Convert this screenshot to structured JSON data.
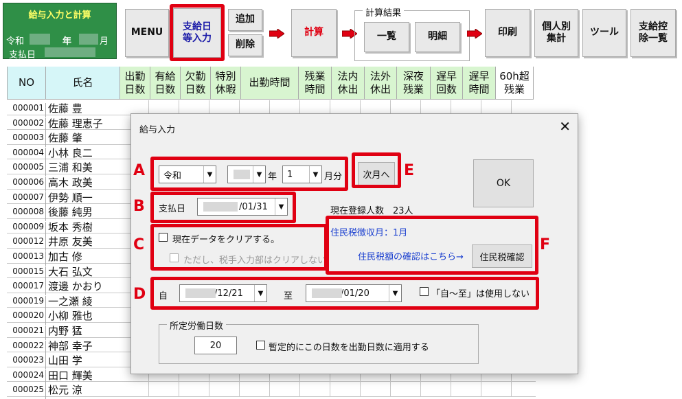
{
  "header": {
    "app_title": "給与入力と計算",
    "era_label": "令和",
    "year_label": "年",
    "month_label": "月",
    "pay_label": "支払日"
  },
  "toolbar": {
    "menu": "MENU",
    "pay_date_entry": "支給日\n等入力",
    "add": "追加",
    "delete": "削除",
    "calc": "計算",
    "calc_result_group": "計算結果",
    "list": "一覧",
    "detail": "明細",
    "print": "印刷",
    "individual": "個人別\n集計",
    "tools": "ツール",
    "deduction_list": "支給控\n除一覧"
  },
  "grid": {
    "headers": [
      "NO",
      "氏名",
      "出勤\n日数",
      "有給\n日数",
      "欠勤\n日数",
      "特別\n休暇",
      "出勤時間",
      "残業\n時間",
      "法内\n休出",
      "法外\n休出",
      "深夜\n残業",
      "遅早\n回数",
      "遅早\n時間",
      "60h超\n残業"
    ],
    "rows": [
      [
        "000001",
        "佐藤 豊"
      ],
      [
        "000002",
        "佐藤 理恵子"
      ],
      [
        "000003",
        "佐藤 肇"
      ],
      [
        "000004",
        "小林 良二"
      ],
      [
        "000005",
        "三浦 和美"
      ],
      [
        "000006",
        "高木 政美"
      ],
      [
        "000007",
        "伊勢 順一"
      ],
      [
        "000008",
        "後藤 純男"
      ],
      [
        "000009",
        "坂本 秀樹"
      ],
      [
        "000012",
        "井原 友美"
      ],
      [
        "000013",
        "加古 修"
      ],
      [
        "000015",
        "大石 弘文"
      ],
      [
        "000017",
        "渡邊 かおり"
      ],
      [
        "000019",
        "一之瀬 綾"
      ],
      [
        "000020",
        "小柳 雅也"
      ],
      [
        "000021",
        "内野 猛"
      ],
      [
        "000022",
        "神部 幸子"
      ],
      [
        "000023",
        "山田 学"
      ],
      [
        "000024",
        "田口 輝美"
      ],
      [
        "000025",
        "松元 涼"
      ]
    ]
  },
  "dialog": {
    "title": "給与入力",
    "close": "✕",
    "era": "令和",
    "year_label": "年",
    "month": "1",
    "month_label": "月分",
    "next_month": "次月へ",
    "ok": "OK",
    "pay_day_label": "支払日",
    "pay_day": "/01/31",
    "registered_count": "現在登録人数　23人",
    "clear_data": "現在データをクリアする。",
    "clear_note": "ただし、税手入力部はクリアしない",
    "resident_tax_month": "住民税徴収月：1月",
    "resident_tax_link": "住民税額の確認はこちら→",
    "resident_tax_button": "住民税確認",
    "from_label": "自",
    "from_date": "/12/21",
    "to_label": "至",
    "to_date": "/01/20",
    "no_range": "「自～至」は使用しない",
    "workdays_group": "所定労働日数",
    "workdays": "20",
    "apply_provisional": "暫定的にこの日数を出勤日数に適用する"
  },
  "callouts": [
    "A",
    "B",
    "C",
    "D",
    "E",
    "F"
  ],
  "colors": {
    "accent_red": "#e00012",
    "logo_green": "#2f8f47",
    "header_green": "#d8f5d0"
  }
}
